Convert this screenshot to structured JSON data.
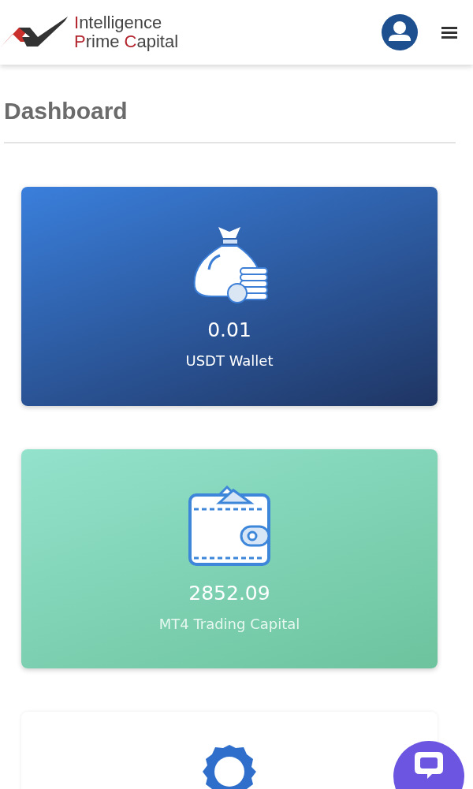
{
  "header": {
    "logo_lines": [
      "Intelligence",
      "Prime Capital"
    ]
  },
  "page": {
    "title": "Dashboard"
  },
  "cards": [
    {
      "kind": "wallet-bag",
      "value": "0.01",
      "label": "USDT Wallet"
    },
    {
      "kind": "wallet",
      "value": "2852.09",
      "label": "MT4 Trading Capital"
    },
    {
      "kind": "badge"
    }
  ]
}
